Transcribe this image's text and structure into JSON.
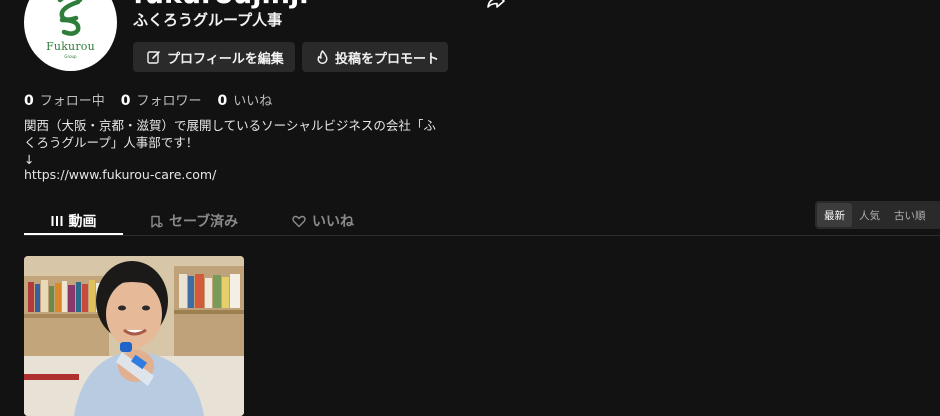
{
  "profile": {
    "username": "fukuroujinji",
    "nickname": "ふくろうグループ人事",
    "logo_text": "Fukurou",
    "logo_subtext": "Group"
  },
  "actions": {
    "edit_label": "プロフィールを編集",
    "promote_label": "投稿をプロモート"
  },
  "stats": [
    {
      "count": "0",
      "label": "フォロー中"
    },
    {
      "count": "0",
      "label": "フォロワー"
    },
    {
      "count": "0",
      "label": "いいね"
    }
  ],
  "bio": {
    "line1": "関西（大阪・京都・滋賀）で展開しているソーシャルビジネスの会社「ふ",
    "line2": "くろうグループ」人事部です！",
    "line3": "↓",
    "link": "https://www.fukurou-care.com/"
  },
  "tabs": [
    {
      "label": "動画",
      "icon": "grid-icon",
      "active": true
    },
    {
      "label": "セーブ済み",
      "icon": "bookmark-icon",
      "active": false
    },
    {
      "label": "いいね",
      "icon": "heart-icon",
      "active": false
    }
  ],
  "sort": {
    "options": [
      "最新",
      "人気",
      "古い順"
    ],
    "selected": "最新"
  },
  "colors": {
    "background": "#121212",
    "button_bg": "#2a2a2a",
    "logo_green": "#2f7d3a"
  }
}
